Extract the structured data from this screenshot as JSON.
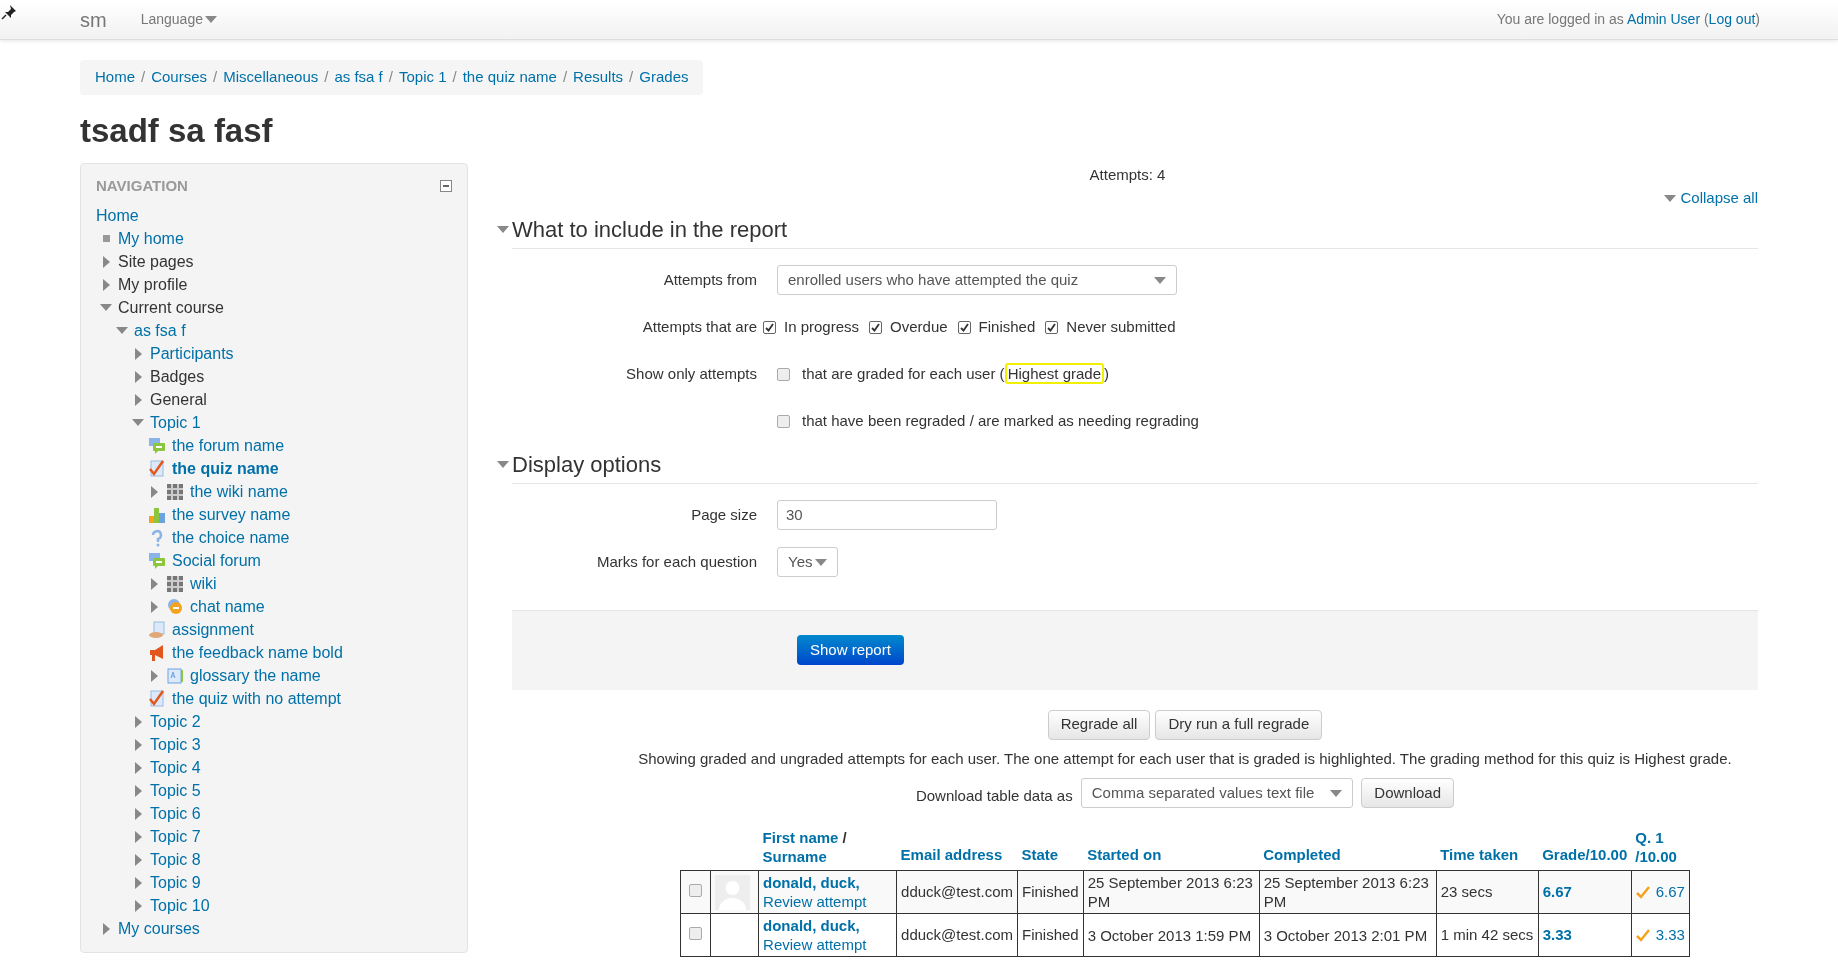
{
  "topbar": {
    "brand": "sm",
    "language": "Language",
    "login": {
      "prefix": "You are logged in as",
      "user": "Admin User",
      "open": "(",
      "logout": "Log out",
      "close": ")"
    }
  },
  "breadcrumb": {
    "separator": "/",
    "items": [
      "Home",
      "Courses",
      "Miscellaneous",
      "as fsa f",
      "Topic 1",
      "the quiz name",
      "Results",
      "Grades"
    ]
  },
  "page_title": "tsadf sa fasf",
  "navigation": {
    "title": "NAVIGATION",
    "items": [
      {
        "label": "Home",
        "link": true,
        "children": [
          {
            "label": "My home",
            "link": true,
            "kind": "bullet"
          },
          {
            "label": "Site pages",
            "link": false,
            "expanded": false
          },
          {
            "label": "My profile",
            "link": false,
            "expanded": false
          },
          {
            "label": "Current course",
            "link": false,
            "expanded": true,
            "children": [
              {
                "label": "as fsa f",
                "link": true,
                "expanded": true,
                "children": [
                  {
                    "label": "Participants",
                    "link": true,
                    "expanded": false
                  },
                  {
                    "label": "Badges",
                    "link": false,
                    "expanded": false
                  },
                  {
                    "label": "General",
                    "link": false,
                    "expanded": false
                  },
                  {
                    "label": "Topic 1",
                    "link": true,
                    "expanded": true,
                    "children": [
                      {
                        "label": "the forum name",
                        "link": true,
                        "kind": "forum"
                      },
                      {
                        "label": "the quiz name",
                        "link": true,
                        "kind": "quiz",
                        "current": true
                      },
                      {
                        "label": "the wiki name",
                        "link": true,
                        "kind": "wiki",
                        "expanded": false
                      },
                      {
                        "label": "the survey name",
                        "link": true,
                        "kind": "survey"
                      },
                      {
                        "label": "the choice name",
                        "link": true,
                        "kind": "choice"
                      },
                      {
                        "label": "Social forum",
                        "link": true,
                        "kind": "forum"
                      },
                      {
                        "label": "wiki",
                        "link": true,
                        "kind": "wiki",
                        "expanded": false
                      },
                      {
                        "label": "chat name",
                        "link": true,
                        "kind": "chat",
                        "expanded": false
                      },
                      {
                        "label": "assignment",
                        "link": true,
                        "kind": "assignment"
                      },
                      {
                        "label": "the feedback name bold",
                        "link": true,
                        "kind": "feedback"
                      },
                      {
                        "label": "glossary the name",
                        "link": true,
                        "kind": "glossary",
                        "expanded": false
                      },
                      {
                        "label": "the quiz with no attempt",
                        "link": true,
                        "kind": "quiz",
                        "current": false
                      }
                    ]
                  },
                  {
                    "label": "Topic 2",
                    "link": true,
                    "expanded": false
                  },
                  {
                    "label": "Topic 3",
                    "link": true,
                    "expanded": false
                  },
                  {
                    "label": "Topic 4",
                    "link": true,
                    "expanded": false
                  },
                  {
                    "label": "Topic 5",
                    "link": true,
                    "expanded": false
                  },
                  {
                    "label": "Topic 6",
                    "link": true,
                    "expanded": false
                  },
                  {
                    "label": "Topic 7",
                    "link": true,
                    "expanded": false
                  },
                  {
                    "label": "Topic 8",
                    "link": true,
                    "expanded": false
                  },
                  {
                    "label": "Topic 9",
                    "link": true,
                    "expanded": false
                  },
                  {
                    "label": "Topic 10",
                    "link": true,
                    "expanded": false
                  }
                ]
              }
            ]
          },
          {
            "label": "My courses",
            "link": true,
            "expanded": false
          }
        ]
      }
    ]
  },
  "attempts_count": "Attempts: 4",
  "collapse_all": "Collapse all",
  "sections": [
    {
      "legend": "What to include in the report",
      "expanded": true,
      "fields": [
        {
          "kind": "select",
          "label": "Attempts from",
          "value": "enrolled users who have attempted the quiz"
        },
        {
          "kind": "checkgroup",
          "label": "Attempts that are",
          "options": [
            {
              "label": "In progress",
              "checked": true
            },
            {
              "label": "Overdue",
              "checked": true
            },
            {
              "label": "Finished",
              "checked": true
            },
            {
              "label": "Never submitted",
              "checked": true
            }
          ]
        },
        {
          "kind": "checkbox",
          "label": "Show only attempts",
          "checked": false,
          "text": "that are graded for each user (",
          "highlight": "Highest grade",
          "after": ")"
        },
        {
          "kind": "checkbox",
          "checked": false,
          "text": "that have been regraded / are marked as needing regrading"
        }
      ]
    },
    {
      "legend": "Display options",
      "expanded": true,
      "fields": [
        {
          "kind": "input",
          "label": "Page size",
          "value": "30"
        },
        {
          "kind": "smallselect",
          "label": "Marks for each question",
          "value": "Yes"
        }
      ]
    }
  ],
  "submit": "Show report",
  "regrade_buttons": [
    "Regrade all",
    "Dry run a full regrade"
  ],
  "info": "Showing graded and ungraded attempts for each user. The one attempt for each user that is graded is highlighted. The grading method for this quiz is Highest grade.",
  "download": {
    "label": "Download table data as",
    "format": "Comma separated values text file",
    "button": "Download"
  },
  "table": {
    "name_header": {
      "first": "First name",
      "separator": "/",
      "second": "Surname"
    },
    "columns": [
      "Email address",
      "State",
      "Started on",
      "Completed",
      "Time taken",
      "Grade/10.00"
    ],
    "q_header": [
      "Q. 1",
      "/10.00"
    ],
    "rows": [
      {
        "checked": false,
        "picture": true,
        "name": "donald, duck,",
        "review": "Review attempt",
        "email": "dduck@test.com",
        "state": "Finished",
        "started": "25 September 2013 6:23 PM",
        "completed": "25 September 2013 6:23 PM",
        "time": "23 secs",
        "grade": "6.67",
        "q1": "6.67"
      },
      {
        "checked": false,
        "picture": false,
        "name": "donald, duck,",
        "review": "Review attempt",
        "email": "dduck@test.com",
        "state": "Finished",
        "started": "3 October 2013 1:59 PM",
        "completed": "3 October 2013 2:01 PM",
        "time": "1 min 42 secs",
        "grade": "3.33",
        "q1": "3.33"
      }
    ]
  }
}
